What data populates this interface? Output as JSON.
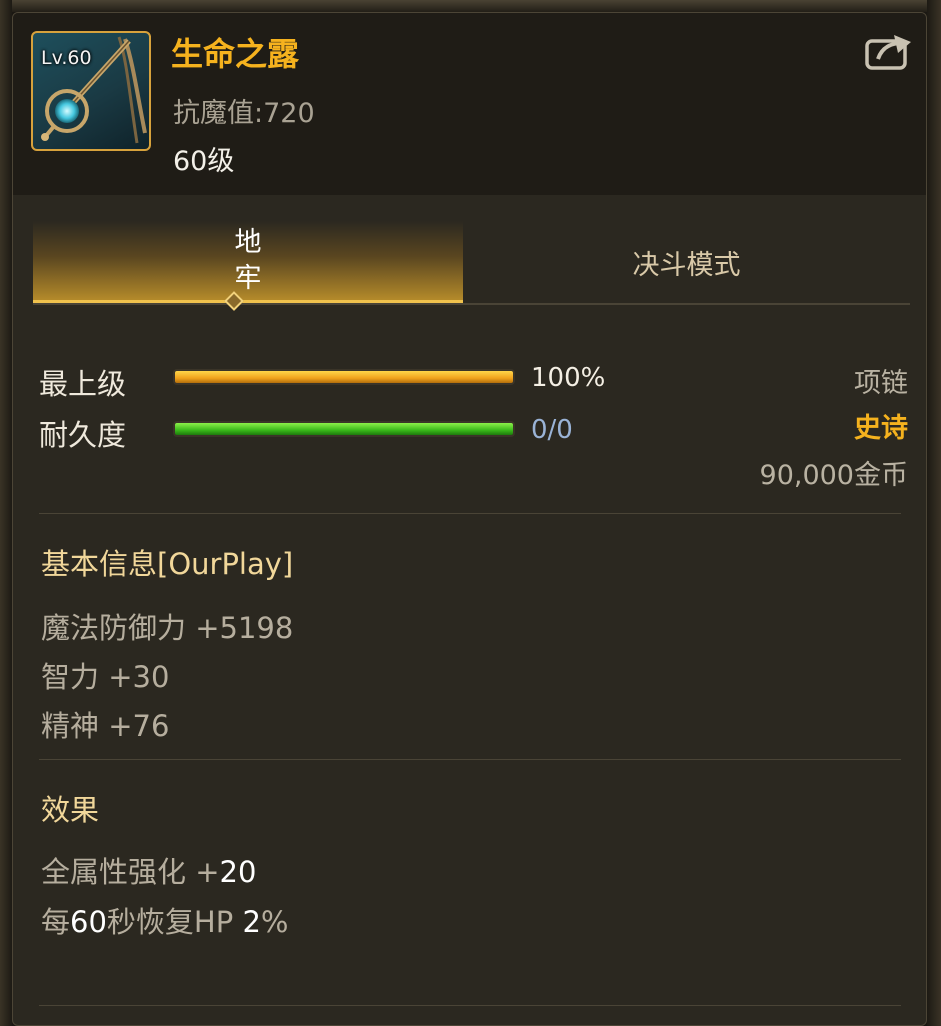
{
  "item": {
    "level_badge": "Lv.60",
    "name": "生命之露",
    "stat": "抗魔值:720",
    "level_text": "60级"
  },
  "share_icon": "share-icon",
  "tabs": [
    {
      "label": "地牢",
      "active": true
    },
    {
      "label": "决斗模式",
      "active": false
    }
  ],
  "bars": {
    "top_grade": {
      "label": "最上级",
      "value_text": "100%",
      "fill": 1.0
    },
    "durability": {
      "label": "耐久度",
      "value_text": "0/0",
      "fill": 1.0
    }
  },
  "info": {
    "slot": "项链",
    "rarity": "史诗",
    "price": "90,000金币"
  },
  "basic_info": {
    "title": "基本信息[OurPlay]",
    "stats": [
      {
        "name": "魔法防御力 ",
        "value": "+5198"
      },
      {
        "name": "智力 ",
        "value": "+30"
      },
      {
        "name": "精神 ",
        "value": "+76"
      }
    ]
  },
  "effects": {
    "title": "效果",
    "lines": [
      {
        "pre": "全属性强化 +",
        "num": "20",
        "mid": "",
        "num2": "",
        "post": ""
      },
      {
        "pre": "每",
        "num": "60",
        "mid": "秒恢复HP ",
        "num2": "2",
        "post": "%"
      }
    ]
  },
  "colors": {
    "accent_gold": "#f5b21e",
    "rarity_epic": "#f5b21e",
    "bar_orange": "#f0a21c",
    "bar_green": "#3ab81a",
    "durability_text": "#9ab3d6"
  }
}
